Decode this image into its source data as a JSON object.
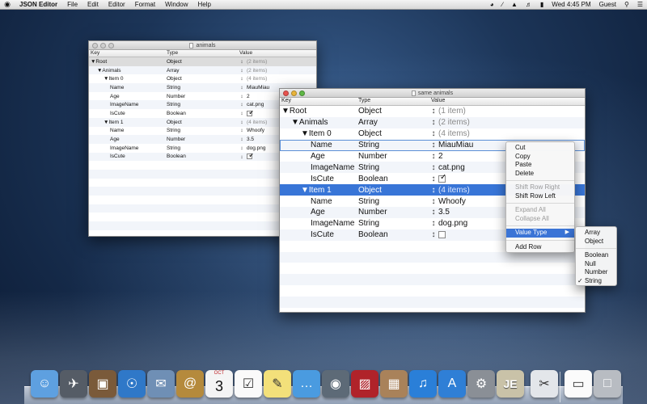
{
  "menubar": {
    "apple": "",
    "items": [
      "JSON Editor",
      "File",
      "Edit",
      "Editor",
      "Format",
      "Window",
      "Help"
    ],
    "clock": "Wed 4:45 PM",
    "user": "Guest"
  },
  "windows": [
    {
      "title": "animals",
      "headers": {
        "key": "Key",
        "type": "Type",
        "value": "Value"
      },
      "rows": [
        {
          "key": "▼Root",
          "type": "Object",
          "value": "(2 items)",
          "muted": true
        },
        {
          "key": "▼Animals",
          "type": "Array",
          "value": "(2 items)",
          "muted": true
        },
        {
          "key": "▼Item 0",
          "type": "Object",
          "value": "(4 items)",
          "muted": true
        },
        {
          "key": "Name",
          "type": "String",
          "value": "MiauMiau"
        },
        {
          "key": "Age",
          "type": "Number",
          "value": "2"
        },
        {
          "key": "ImageName",
          "type": "String",
          "value": "cat.png"
        },
        {
          "key": "IsCute",
          "type": "Boolean",
          "value": "",
          "checkbox": true,
          "checked": true
        },
        {
          "key": "▼Item 1",
          "type": "Object",
          "value": "(4 items)",
          "muted": true
        },
        {
          "key": "Name",
          "type": "String",
          "value": "Whoofy"
        },
        {
          "key": "Age",
          "type": "Number",
          "value": "3.5"
        },
        {
          "key": "ImageName",
          "type": "String",
          "value": "dog.png"
        },
        {
          "key": "IsCute",
          "type": "Boolean",
          "value": "",
          "checkbox": true,
          "checked": true
        }
      ]
    },
    {
      "title": "same animals",
      "headers": {
        "key": "Key",
        "type": "Type",
        "value": "Value"
      },
      "rows": [
        {
          "key": "▼Root",
          "type": "Object",
          "value": "(1 item)",
          "muted": true
        },
        {
          "key": "▼Animals",
          "type": "Array",
          "value": "(2 items)",
          "muted": true
        },
        {
          "key": "▼Item 0",
          "type": "Object",
          "value": "(4 items)",
          "muted": true
        },
        {
          "key": "Name",
          "type": "String",
          "value": "MiauMiau"
        },
        {
          "key": "Age",
          "type": "Number",
          "value": "2"
        },
        {
          "key": "ImageName",
          "type": "String",
          "value": "cat.png"
        },
        {
          "key": "IsCute",
          "type": "Boolean",
          "value": "",
          "checkbox": true,
          "checked": true
        },
        {
          "key": "▼Item 1",
          "type": "Object",
          "value": "(4 items)",
          "muted": true
        },
        {
          "key": "Name",
          "type": "String",
          "value": "Whoofy"
        },
        {
          "key": "Age",
          "type": "Number",
          "value": "3.5"
        },
        {
          "key": "ImageName",
          "type": "String",
          "value": "dog.png"
        },
        {
          "key": "IsCute",
          "type": "Boolean",
          "value": "",
          "checkbox": true,
          "checked": false
        }
      ]
    }
  ],
  "context_menu": {
    "items": [
      {
        "label": "Cut",
        "enabled": true
      },
      {
        "label": "Copy",
        "enabled": true
      },
      {
        "label": "Paste",
        "enabled": true
      },
      {
        "label": "Delete",
        "enabled": true
      },
      {
        "separator": true
      },
      {
        "label": "Shift Row Right",
        "enabled": false
      },
      {
        "label": "Shift Row Left",
        "enabled": true
      },
      {
        "separator": true
      },
      {
        "label": "Expand All",
        "enabled": false
      },
      {
        "label": "Collapse All",
        "enabled": false
      },
      {
        "separator": true
      },
      {
        "label": "Value Type",
        "enabled": true,
        "highlighted": true,
        "submenu": true
      },
      {
        "separator": true
      },
      {
        "label": "Add Row",
        "enabled": true
      }
    ]
  },
  "submenu": {
    "items": [
      {
        "label": "Array"
      },
      {
        "label": "Object"
      },
      {
        "separator": true
      },
      {
        "label": "Boolean"
      },
      {
        "label": "Null"
      },
      {
        "label": "Number"
      },
      {
        "label": "String",
        "checked": true
      }
    ]
  },
  "dock": {
    "icons": [
      "finder-icon",
      "launchpad-icon",
      "photo-browser-icon",
      "safari-icon",
      "mail-icon",
      "address-book-icon",
      "calendar-icon",
      "reminders-icon",
      "notes-icon",
      "messages-icon",
      "facetime-icon",
      "photo-booth-icon",
      "iphoto-icon",
      "itunes-icon",
      "app-store-icon",
      "system-preferences-icon",
      "json-editor-icon",
      "preview-icon",
      "document-icon",
      "trash-icon"
    ],
    "calendar_day": "3",
    "calendar_month": "OCT",
    "json_editor_label": "JE"
  },
  "colors": {
    "selection": "#3875d7",
    "menu_highlight": "#3a74d6",
    "desktop": "#1c3558"
  }
}
